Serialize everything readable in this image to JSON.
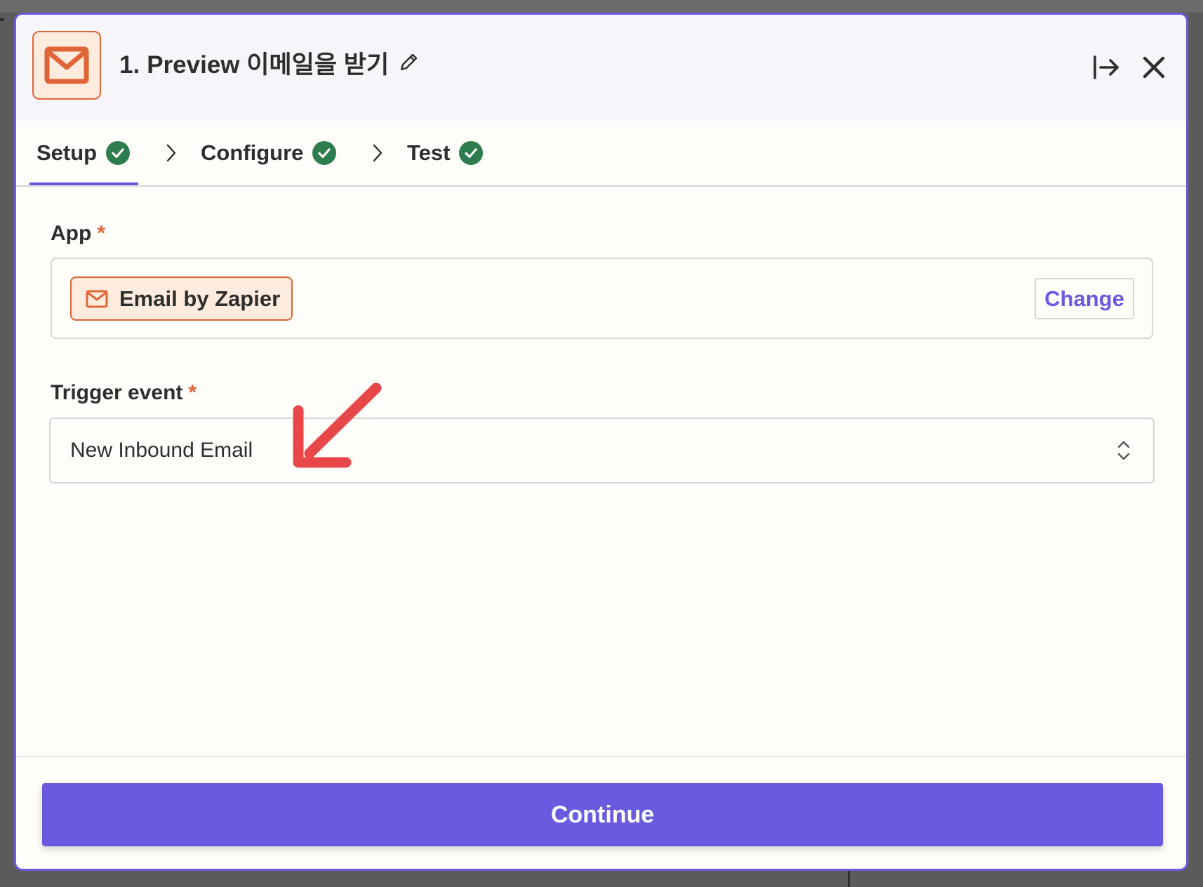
{
  "header": {
    "step_number": "1.",
    "title": "Preview 이메일을 받기",
    "app_icon": "envelope-icon",
    "edit_icon": "pencil-icon",
    "exit_icon": "exit-panel-icon",
    "close_icon": "close-icon"
  },
  "tabs": [
    {
      "label": "Setup",
      "status": "complete",
      "active": true
    },
    {
      "label": "Configure",
      "status": "complete",
      "active": false
    },
    {
      "label": "Test",
      "status": "complete",
      "active": false
    }
  ],
  "app_field": {
    "label": "App",
    "required_mark": "*",
    "selected_app": "Email by Zapier",
    "change_label": "Change"
  },
  "trigger_field": {
    "label": "Trigger event",
    "required_mark": "*",
    "selected_value": "New Inbound Email"
  },
  "footer": {
    "continue_label": "Continue"
  },
  "colors": {
    "accent": "#6a5ae0",
    "brand_orange": "#e06536",
    "success_green": "#2e7d4f",
    "annotation_red": "#e8474a",
    "header_bg": "#f5f5fa",
    "panel_bg": "#fffdf9"
  }
}
